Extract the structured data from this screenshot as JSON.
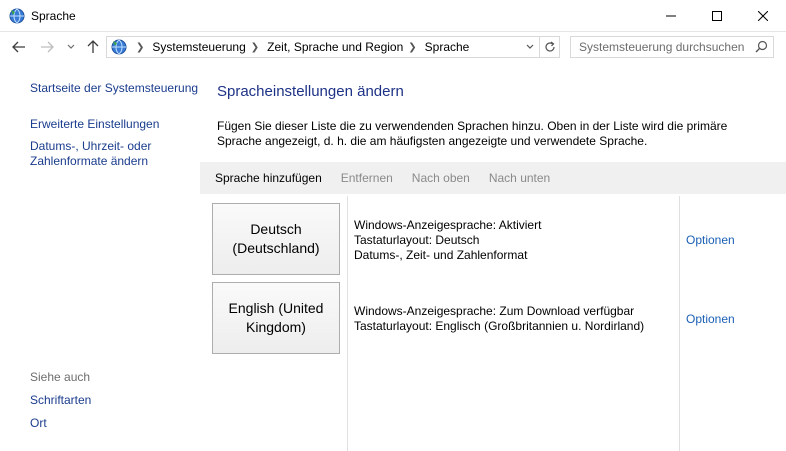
{
  "window": {
    "title": "Sprache"
  },
  "address_bar": {
    "crumbs": [
      "Systemsteuerung",
      "Zeit, Sprache und Region",
      "Sprache"
    ],
    "search_placeholder": "Systemsteuerung durchsuchen"
  },
  "sidebar": {
    "home_link": "Startseite der Systemsteuerung",
    "links": [
      "Erweiterte Einstellungen",
      "Datums-, Uhrzeit- oder Zahlenformate ändern"
    ],
    "see_also_label": "Siehe auch",
    "see_also_links": [
      "Schriftarten",
      "Ort"
    ]
  },
  "main": {
    "title": "Spracheinstellungen ändern",
    "description": "Fügen Sie dieser Liste die zu verwendenden Sprachen hinzu. Oben in der Liste wird die primäre Sprache angezeigt, d. h. die am häufigsten angezeigte und verwendete Sprache.",
    "toolbar": {
      "add": "Sprache hinzufügen",
      "remove": "Entfernen",
      "move_up": "Nach oben",
      "move_down": "Nach unten"
    },
    "languages": [
      {
        "name": "Deutsch (Deutschland)",
        "details": [
          "Windows-Anzeigesprache: Aktiviert",
          "Tastaturlayout: Deutsch",
          "Datums-, Zeit- und Zahlenformat"
        ],
        "options": "Optionen"
      },
      {
        "name": "English (United Kingdom)",
        "details": [
          "Windows-Anzeigesprache: Zum Download verfügbar",
          "Tastaturlayout: Englisch (Großbritannien u. Nordirland)"
        ],
        "options": "Optionen"
      }
    ]
  },
  "colors": {
    "link": "#1a3c8d",
    "title": "#1e3287",
    "toolbar_bg": "#f0f0f0"
  }
}
